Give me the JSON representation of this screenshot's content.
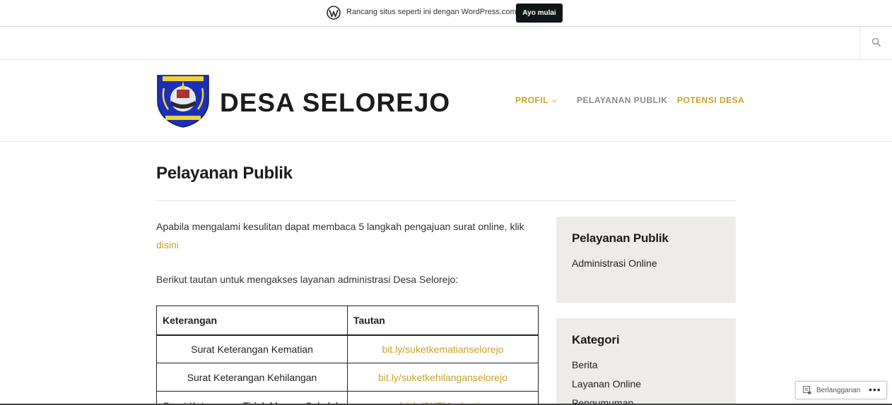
{
  "promo": {
    "text": "Rancang situs seperti ini dengan WordPress.com",
    "button": "Ayo mulai",
    "icon": "wordpress-icon"
  },
  "search": {
    "icon": "search-icon"
  },
  "header": {
    "site_title": "DESA SELOREJO",
    "logo": "village-emblem-logo",
    "nav": [
      {
        "label": "PROFIL",
        "has_submenu": true,
        "color": "#c9a227"
      },
      {
        "label": "PELAYANAN PUBLIK",
        "color": "#888888"
      },
      {
        "label": "POTENSI DESA",
        "color": "#c9a227"
      }
    ]
  },
  "page": {
    "title": "Pelayanan Publik",
    "paragraph1": "Apabila mengalami kesulitan dapat membaca 5 langkah pengajuan surat online, klik",
    "paragraph1_link": "disini",
    "paragraph2": "Berikut tautan untuk mengakses layanan administrasi Desa Selorejo:"
  },
  "table": {
    "headers": [
      "Keterangan",
      "Tautan"
    ],
    "rows": [
      {
        "keterangan": "Surat Keterangan Kematian",
        "tautan": "bit.ly/suketkematianselorejo"
      },
      {
        "keterangan": "Surat Keterangan Kehilangan",
        "tautan": "bit.ly/suketkehilanganselorejo"
      },
      {
        "keterangan": "Surat Keterangan Tidak Mampu Sekolah",
        "tautan": "bit.ly/SKTMselorejo"
      }
    ]
  },
  "sidebar": {
    "widget1": {
      "title": "Pelayanan Publik",
      "items": [
        "Administrasi Online"
      ]
    },
    "widget2": {
      "title": "Kategori",
      "items": [
        "Berita",
        "Layanan Online",
        "Pengumuman"
      ]
    }
  },
  "follow": {
    "label": "Berlangganan",
    "more": "•••"
  },
  "colors": {
    "accent": "#c9a227",
    "widget_bg": "#eeece9",
    "promo_button": "#101517"
  }
}
